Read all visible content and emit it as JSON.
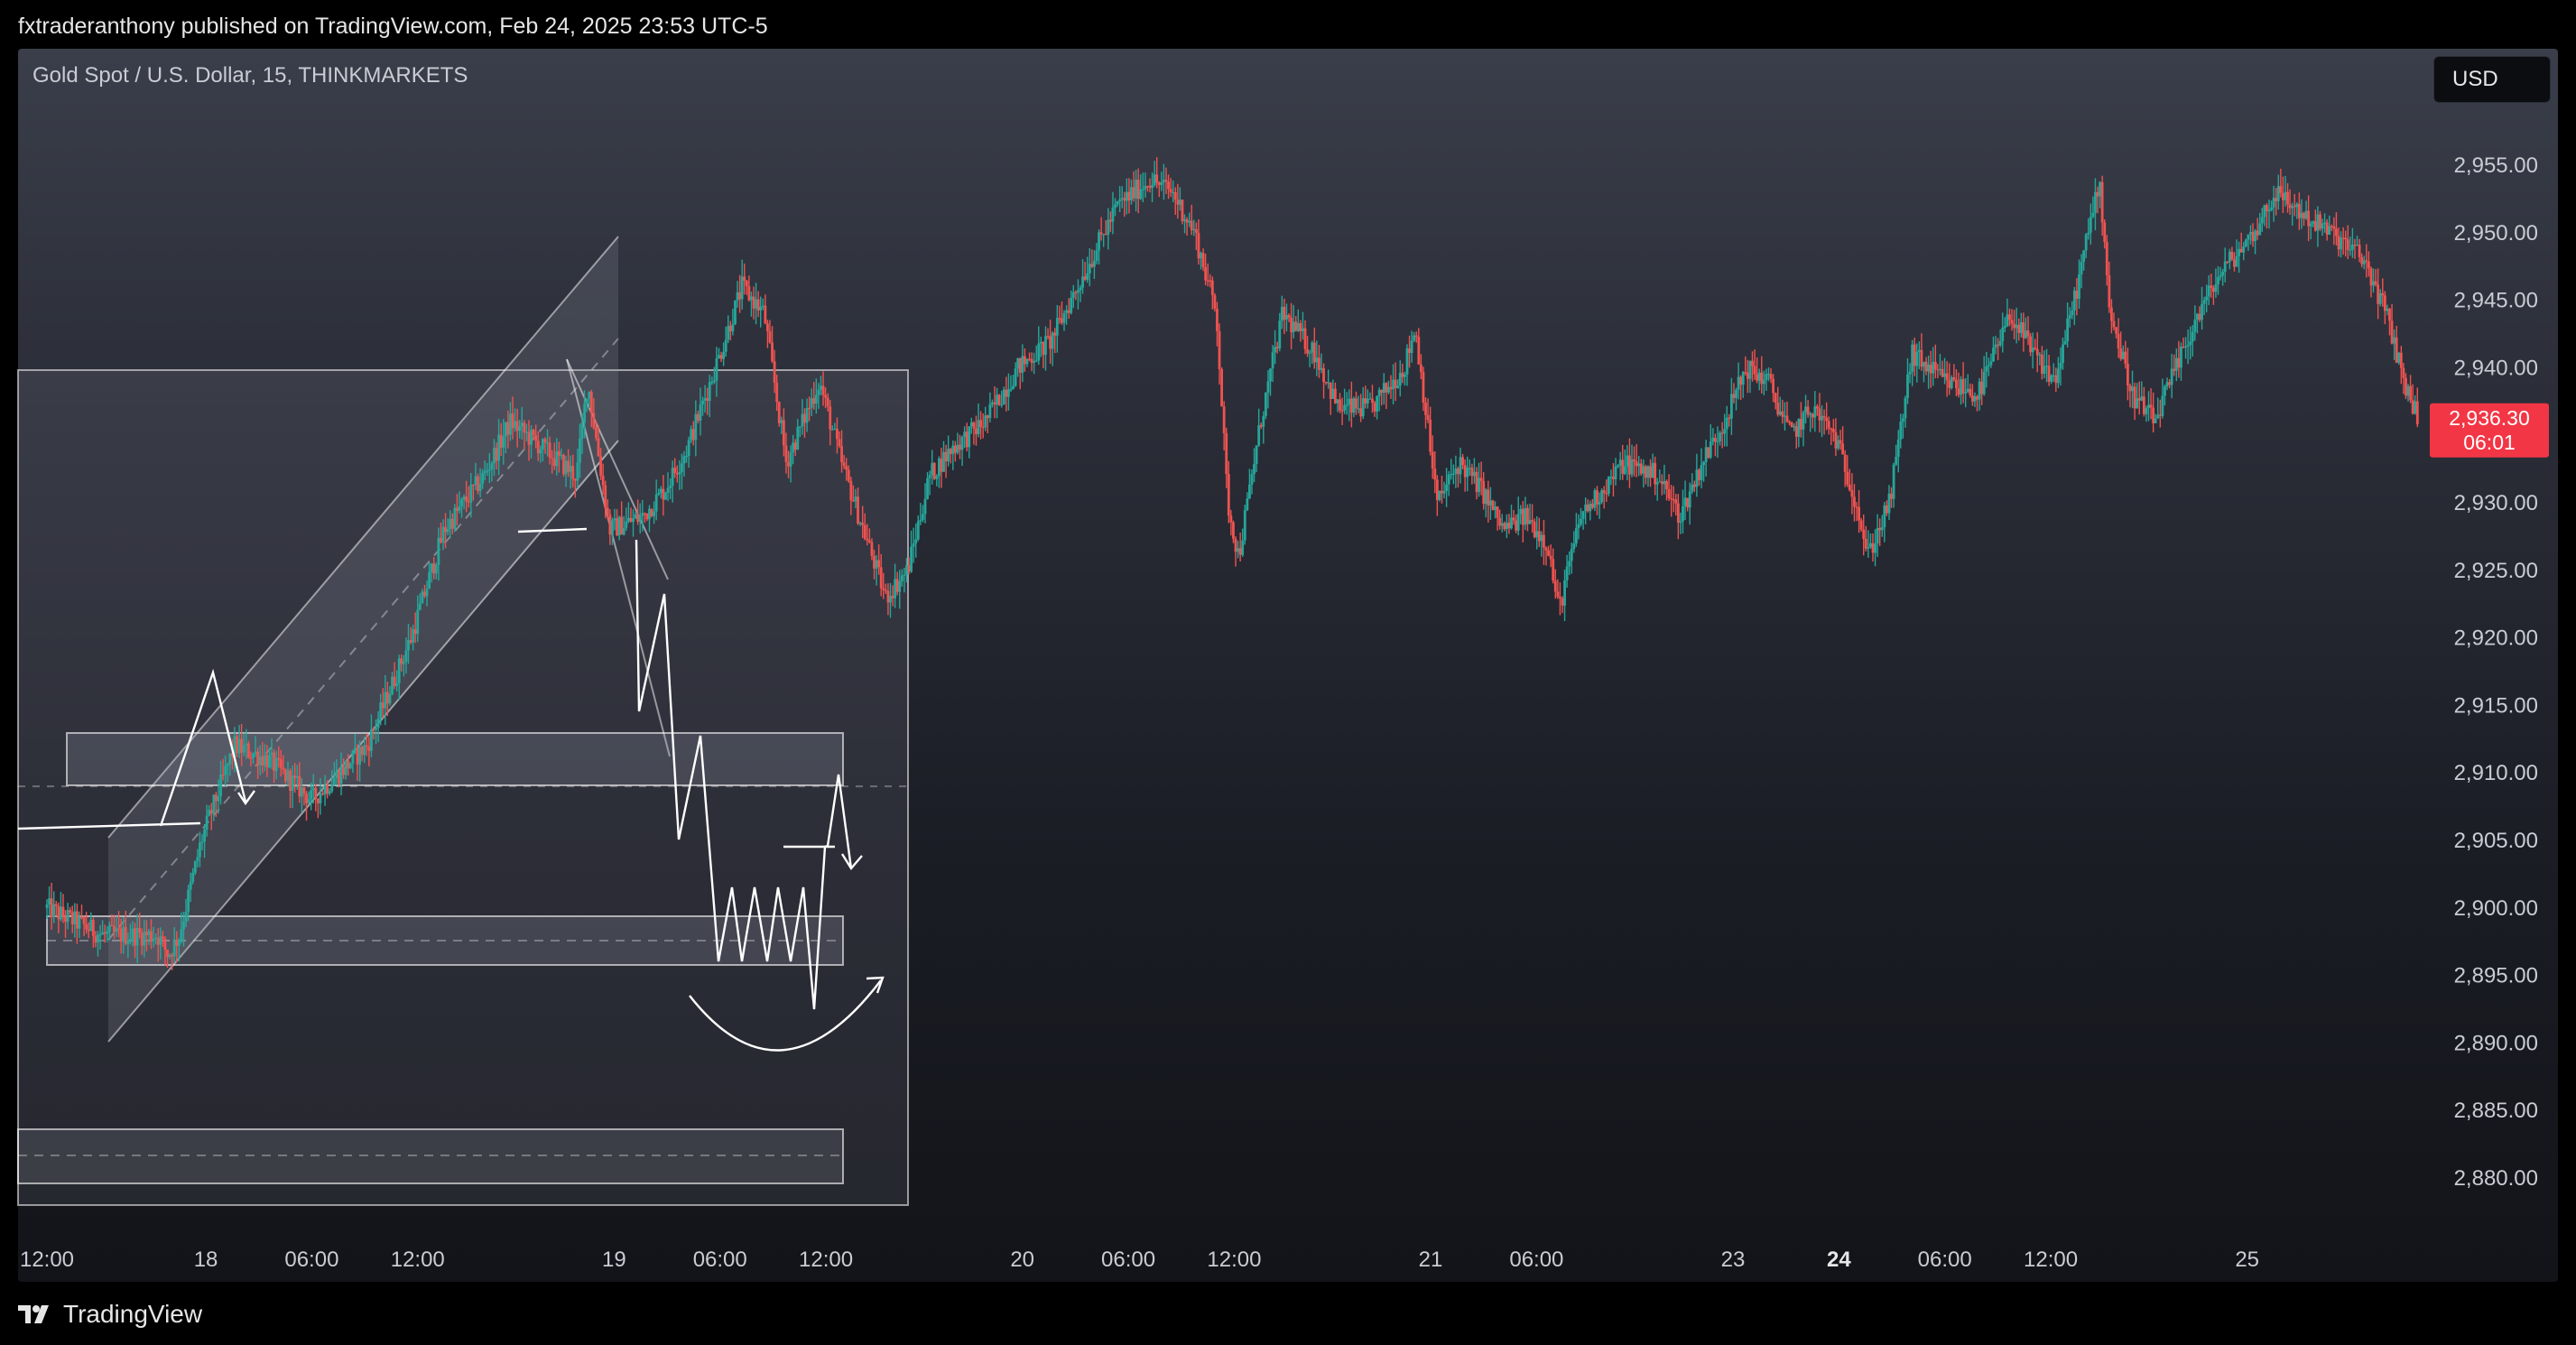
{
  "header": {
    "published": "fxtraderanthony published on TradingView.com, Feb 24, 2025 23:53 UTC-5"
  },
  "symbol": {
    "title": "Gold Spot / U.S. Dollar, 15, THINKMARKETS"
  },
  "currency_button": "USD",
  "footer": {
    "brand": "TradingView"
  },
  "colors": {
    "up": "#26a69a",
    "down": "#ef5350",
    "price_badge": "#f23645"
  },
  "chart_data": {
    "type": "candlestick",
    "ylim": [
      2877,
      2959
    ],
    "y_ticks": [
      "2,955.00",
      "2,950.00",
      "2,945.00",
      "2,940.00",
      "2,935.00",
      "2,930.00",
      "2,925.00",
      "2,920.00",
      "2,915.00",
      "2,910.00",
      "2,905.00",
      "2,900.00",
      "2,895.00",
      "2,890.00",
      "2,885.00",
      "2,880.00"
    ],
    "x_ticks": [
      {
        "label": "12:00",
        "t": 0
      },
      {
        "label": "18",
        "t": 0.72
      },
      {
        "label": "06:00",
        "t": 1.2
      },
      {
        "label": "12:00",
        "t": 1.68
      },
      {
        "label": "19",
        "t": 2.57
      },
      {
        "label": "06:00",
        "t": 3.05
      },
      {
        "label": "12:00",
        "t": 3.53
      },
      {
        "label": "20",
        "t": 4.42
      },
      {
        "label": "06:00",
        "t": 4.9
      },
      {
        "label": "12:00",
        "t": 5.38
      },
      {
        "label": "21",
        "t": 6.27
      },
      {
        "label": "06:00",
        "t": 6.75
      },
      {
        "label": "23",
        "t": 7.64
      },
      {
        "label": "24",
        "t": 8.12
      },
      {
        "label": "06:00",
        "t": 8.6
      },
      {
        "label": "12:00",
        "t": 9.08
      },
      {
        "label": "25",
        "t": 9.97
      }
    ],
    "last_price": "2,936.30",
    "countdown": "06:01",
    "dashed_price_line": 2909.0,
    "price_path": [
      [
        0,
        2900
      ],
      [
        0.25,
        2898
      ],
      [
        0.5,
        2898
      ],
      [
        0.55,
        2896.5
      ],
      [
        0.6,
        2898
      ],
      [
        0.7,
        2905
      ],
      [
        0.85,
        2912
      ],
      [
        1.0,
        2911
      ],
      [
        1.2,
        2908
      ],
      [
        1.45,
        2912
      ],
      [
        1.65,
        2920
      ],
      [
        1.8,
        2928
      ],
      [
        1.98,
        2932
      ],
      [
        2.1,
        2936
      ],
      [
        2.25,
        2934
      ],
      [
        2.4,
        2932
      ],
      [
        2.45,
        2939
      ],
      [
        2.55,
        2928
      ],
      [
        2.7,
        2929
      ],
      [
        2.8,
        2931
      ],
      [
        2.9,
        2934
      ],
      [
        3.05,
        2941
      ],
      [
        3.15,
        2946
      ],
      [
        3.25,
        2944
      ],
      [
        3.35,
        2933
      ],
      [
        3.5,
        2939
      ],
      [
        3.6,
        2933
      ],
      [
        3.7,
        2928
      ],
      [
        3.8,
        2923
      ],
      [
        3.9,
        2925
      ],
      [
        4.0,
        2932
      ],
      [
        4.1,
        2934
      ],
      [
        4.25,
        2936
      ],
      [
        4.4,
        2940
      ],
      [
        4.55,
        2942
      ],
      [
        4.7,
        2947
      ],
      [
        4.85,
        2952
      ],
      [
        5.0,
        2954
      ],
      [
        5.1,
        2953
      ],
      [
        5.2,
        2950
      ],
      [
        5.3,
        2944
      ],
      [
        5.35,
        2930
      ],
      [
        5.4,
        2926
      ],
      [
        5.5,
        2936
      ],
      [
        5.6,
        2944
      ],
      [
        5.75,
        2941
      ],
      [
        5.85,
        2937
      ],
      [
        6.0,
        2937
      ],
      [
        6.15,
        2940
      ],
      [
        6.2,
        2943
      ],
      [
        6.3,
        2930
      ],
      [
        6.4,
        2933
      ],
      [
        6.5,
        2931
      ],
      [
        6.6,
        2928
      ],
      [
        6.7,
        2929
      ],
      [
        6.8,
        2927
      ],
      [
        6.85,
        2922
      ],
      [
        6.95,
        2929
      ],
      [
        7.05,
        2931
      ],
      [
        7.15,
        2933
      ],
      [
        7.3,
        2932
      ],
      [
        7.4,
        2929
      ],
      [
        7.5,
        2933
      ],
      [
        7.6,
        2936
      ],
      [
        7.7,
        2940
      ],
      [
        7.8,
        2939
      ],
      [
        7.9,
        2935
      ],
      [
        8.0,
        2937
      ],
      [
        8.1,
        2935
      ],
      [
        8.2,
        2930
      ],
      [
        8.25,
        2926
      ],
      [
        8.35,
        2930
      ],
      [
        8.45,
        2941
      ],
      [
        8.6,
        2939
      ],
      [
        8.75,
        2938
      ],
      [
        8.9,
        2944
      ],
      [
        9.0,
        2941
      ],
      [
        9.1,
        2939
      ],
      [
        9.2,
        2946
      ],
      [
        9.3,
        2954
      ],
      [
        9.35,
        2944
      ],
      [
        9.45,
        2938
      ],
      [
        9.55,
        2936
      ],
      [
        9.65,
        2940
      ],
      [
        9.75,
        2944
      ],
      [
        9.85,
        2947
      ],
      [
        10.0,
        2950
      ],
      [
        10.1,
        2953
      ],
      [
        10.25,
        2951
      ],
      [
        10.35,
        2950
      ],
      [
        10.5,
        2948
      ],
      [
        10.6,
        2944
      ],
      [
        10.7,
        2938
      ],
      [
        10.75,
        2936.3
      ]
    ]
  }
}
